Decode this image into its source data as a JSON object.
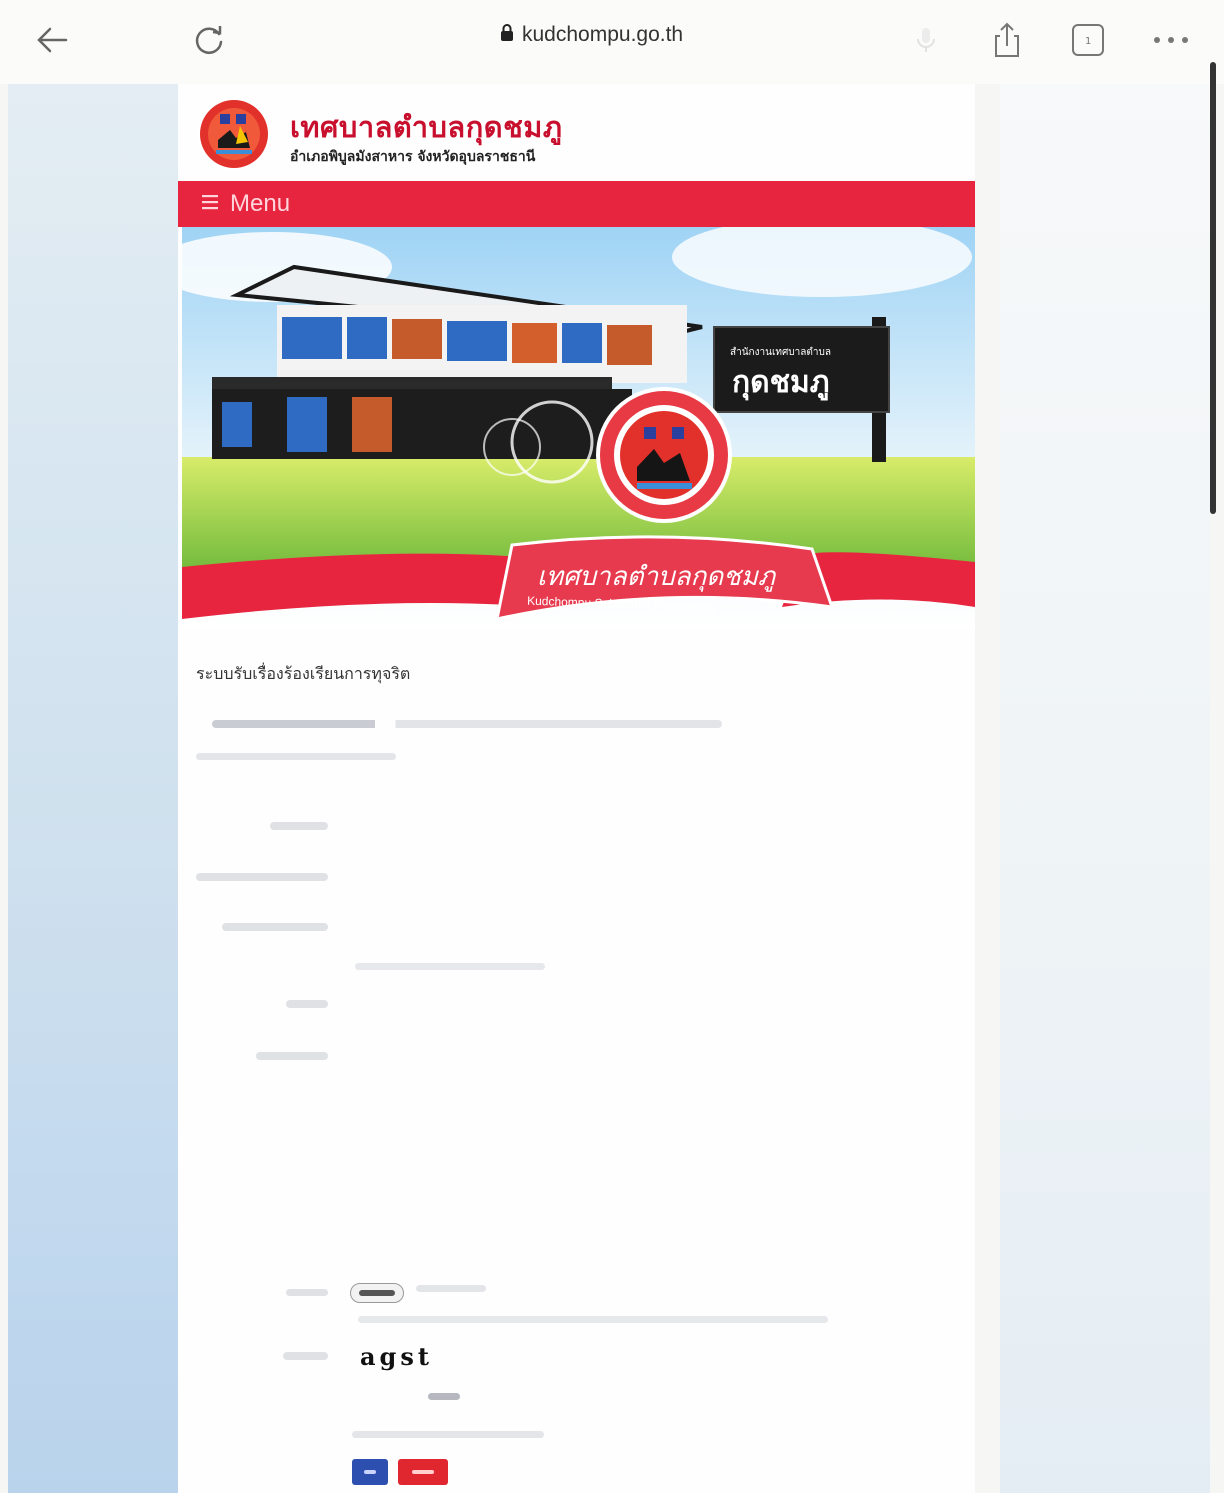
{
  "browser": {
    "url": "kudchompu.go.th",
    "icons": [
      "back-arrow-icon",
      "reload-icon",
      "lock-icon",
      "microphone-icon",
      "share-icon",
      "tabs-icon",
      "more-icon"
    ]
  },
  "header": {
    "title": "เทศบาลตำบลกุดชมภู",
    "subtitle": "อำเภอพิบูลมังสาหาร จังหวัดอุบลราชธานี"
  },
  "menu": {
    "label": "Menu"
  },
  "banner": {
    "sign_small": "สำนักงานเทศบาลตำบล",
    "sign_large": "กุดชมภู",
    "ribbon_thai": "เทศบาลตำบลกุดชมภู",
    "ribbon_en": "Kudchompu Subdistrict Municipality"
  },
  "content": {
    "section_title": "ระบบรับเรื่องร้องเรียนการทุจริต",
    "captcha": "agst"
  },
  "colors": {
    "brand_red": "#e8253f",
    "title_red": "#c8102e",
    "submit_blue": "#2d4fb0",
    "cancel_red": "#e0262e"
  }
}
